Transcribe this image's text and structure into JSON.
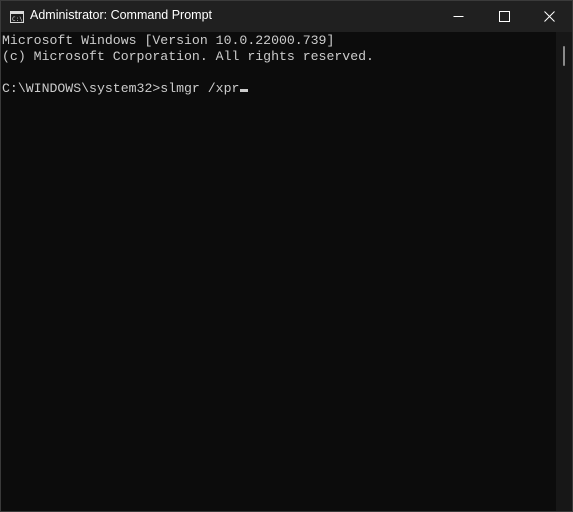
{
  "window": {
    "title": "Administrator: Command Prompt"
  },
  "icons": {
    "app": "command-prompt-icon",
    "minimize": "minimize-icon",
    "maximize": "maximize-icon",
    "close": "close-icon"
  },
  "console": {
    "lines": [
      "Microsoft Windows [Version 10.0.22000.739]",
      "(c) Microsoft Corporation. All rights reserved.",
      "",
      "C:\\WINDOWS\\system32>slmgr /xpr"
    ]
  },
  "colors": {
    "background": "#0c0c0c",
    "titlebar": "#202020",
    "text": "#cccccc"
  }
}
